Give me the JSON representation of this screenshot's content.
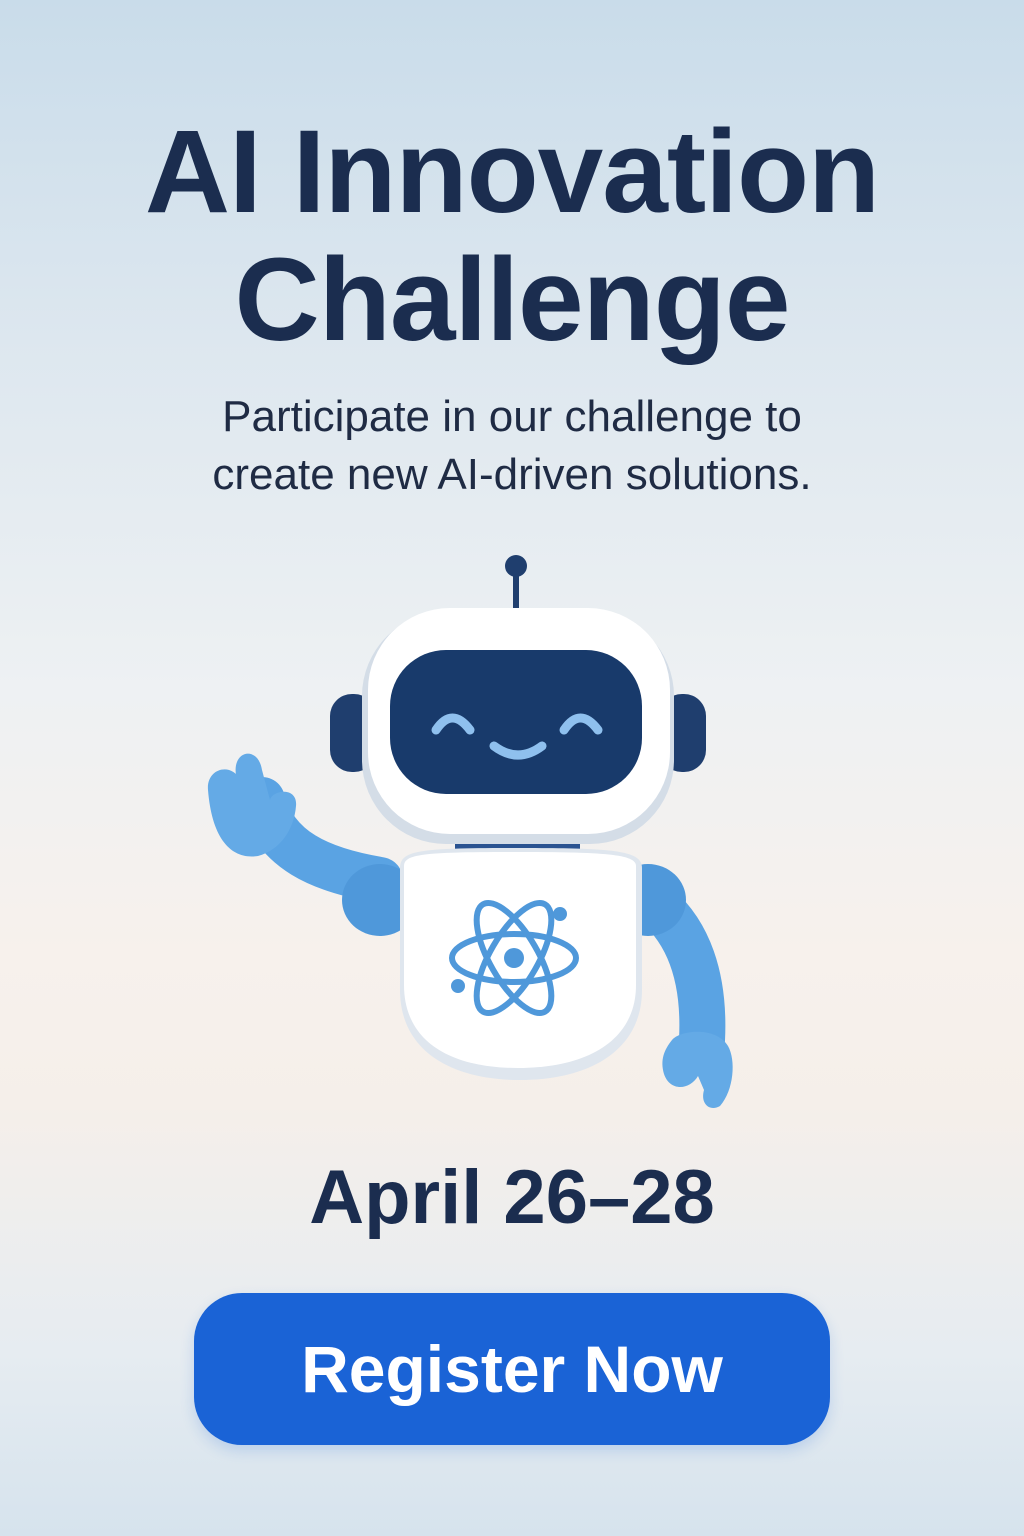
{
  "hero": {
    "title_line1": "AI Innovation",
    "title_line2": "Challenge",
    "subtitle_line1": "Participate in our challenge to",
    "subtitle_line2": "create new AI-driven solutions."
  },
  "illustration": {
    "icon": "robot-icon",
    "chest_icon": "atom-icon",
    "colors": {
      "visor": "#183a6b",
      "face_features": "#8fc0ee",
      "body": "#ffffff",
      "arms": "#5aa3e3",
      "ears": "#1f3e6e"
    }
  },
  "event": {
    "date": "April 26–28"
  },
  "cta": {
    "label": "Register Now",
    "color": "#1a63d6"
  }
}
